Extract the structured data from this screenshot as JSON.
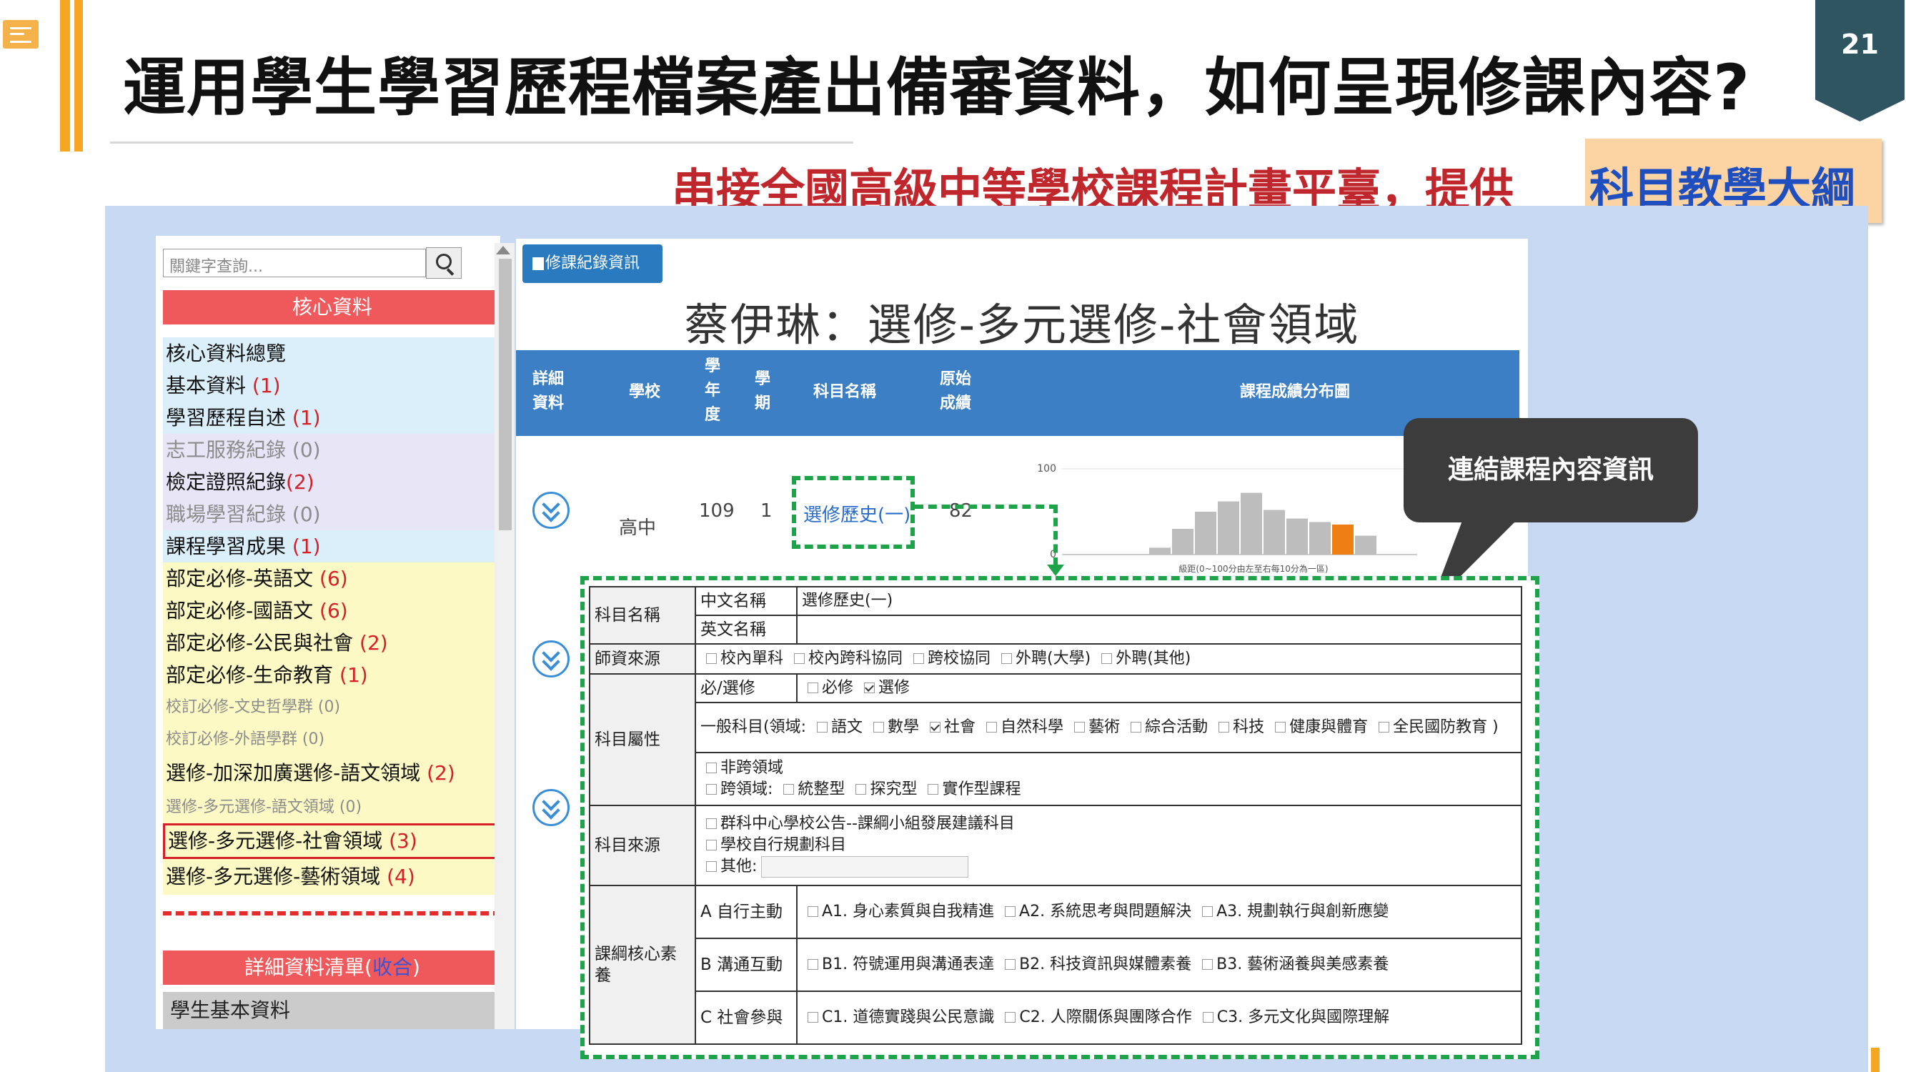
{
  "slide": {
    "title": "運用學生學習歷程檔案產出備審資料，如何呈現修課內容?",
    "page_number": "21",
    "subtitle": "串接全國高級中等學校課程計畫平臺，提供",
    "subtitle_highlight": "科目教學大綱"
  },
  "sidebar": {
    "search_placeholder": "關鍵字查詢...",
    "core_header": "核心資料",
    "items": [
      {
        "label": "核心資料總覽",
        "count": ""
      },
      {
        "label": "基本資料 ",
        "count": "(1)"
      },
      {
        "label": "學習歷程自述 ",
        "count": "(1)"
      },
      {
        "label": "志工服務紀錄 (0)",
        "count": ""
      },
      {
        "label": "檢定證照紀錄",
        "count": "(2)"
      },
      {
        "label": "職場學習紀錄 (0)",
        "count": ""
      },
      {
        "label": "課程學習成果 ",
        "count": "(1)"
      },
      {
        "label": "部定必修-英語文 ",
        "count": "(6)"
      },
      {
        "label": "部定必修-國語文 ",
        "count": "(6)"
      },
      {
        "label": "部定必修-公民與社會 ",
        "count": "(2)"
      },
      {
        "label": "部定必修-生命教育 ",
        "count": "(1)"
      },
      {
        "label": "校訂必修-文史哲學群 (0)",
        "count": ""
      },
      {
        "label": "校訂必修-外語學群 (0)",
        "count": ""
      },
      {
        "label": "選修-加深加廣選修-語文領域 ",
        "count": "(2)"
      },
      {
        "label": "選修-多元選修-語文領域 (0)",
        "count": ""
      },
      {
        "label": "選修-多元選修-社會領域 ",
        "count": "(3)"
      },
      {
        "label": "選修-多元選修-藝術領域 ",
        "count": "(4)"
      }
    ],
    "detail_header": "詳細資料清單(",
    "detail_collapse": "收合",
    "detail_close": ")",
    "student_basic": "學生基本資料"
  },
  "main": {
    "record_button": "修課紀錄資訊",
    "record_title": "蔡伊琳：選修-多元選修-社會領域",
    "columns": {
      "detail": "詳細資料",
      "school": "學校",
      "year": "學年度",
      "term": "學期",
      "subject": "科目名稱",
      "score": "原始成績",
      "dist": "課程成績分布圖"
    },
    "row": {
      "school": "高中",
      "year": "109",
      "term": "1",
      "subject": "選修歷史(一)",
      "score": "82"
    },
    "callout": "連結課程內容資訊"
  },
  "chart_data": {
    "type": "bar",
    "ylim": [
      0,
      100
    ],
    "yticks": [
      "100",
      "0"
    ],
    "xlabel": "級距(0~100分由左至右每10分為一區)",
    "categories": [
      "0-10",
      "10-20",
      "20-30",
      "30-40",
      "40-50",
      "50-60",
      "60-70",
      "70-80",
      "80-90",
      "90-100"
    ],
    "values": [
      8,
      30,
      50,
      62,
      72,
      52,
      42,
      38,
      35,
      22
    ],
    "highlight_index": 8,
    "colors": {
      "bar": "#bdbdbd",
      "highlight": "#f07f13"
    }
  },
  "detail": {
    "subject_name_label": "科目名稱",
    "cn_name_label": "中文名稱",
    "cn_name_value": "選修歷史(一)",
    "en_name_label": "英文名稱",
    "teacher_source_label": "師資來源",
    "teacher_sources": [
      "校內單科",
      "校內跨科協同",
      "跨校協同",
      "外聘(大學)",
      "外聘(其他)"
    ],
    "attribute_label": "科目屬性",
    "req_label": "必/選修",
    "req_options": [
      "必修",
      "選修"
    ],
    "general_prefix": "一般科目(領域:",
    "domains": [
      "語文",
      "數學",
      "社會",
      "自然科學",
      "藝術",
      "綜合活動",
      "科技",
      "健康與體育",
      "全民國防教育"
    ],
    "general_suffix": ")",
    "cross_none": "非跨領域",
    "cross_label": "跨領域:",
    "cross_types": [
      "統整型",
      "探究型",
      "實作型課程"
    ],
    "origin_label": "科目來源",
    "origins": [
      "群科中心學校公告--課綱小組發展建議科目",
      "學校自行規劃科目",
      "其他:"
    ],
    "core_label": "課綱核心素養",
    "core_rows": [
      {
        "group": "A 自行主動",
        "items": [
          "A1. 身心素質與自我精進",
          "A2. 系統思考與問題解決",
          "A3. 規劃執行與創新應變"
        ]
      },
      {
        "group": "B 溝通互動",
        "items": [
          "B1. 符號運用與溝通表達",
          "B2. 科技資訊與媒體素養",
          "B3. 藝術涵養與美感素養"
        ]
      },
      {
        "group": "C 社會參與",
        "items": [
          "C1. 道德實踐與公民意識",
          "C2. 人際關係與團隊合作",
          "C3. 多元文化與國際理解"
        ]
      }
    ]
  }
}
